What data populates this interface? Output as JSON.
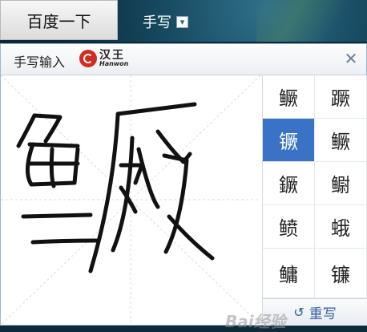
{
  "topbar": {
    "search_button_label": "百度一下",
    "mode_label": "手写",
    "mode_dropdown_icon": "chevron-down-icon"
  },
  "panel": {
    "title": "手写输入",
    "logo": {
      "cn": "汉王",
      "en": "Hanwon"
    },
    "close_label": "✕"
  },
  "candidates": [
    "鳜",
    "蹶",
    "镢",
    "鳜",
    "鐝",
    "鳚",
    "鲼",
    "蛾",
    "鳙",
    "镰"
  ],
  "selected_index": 2,
  "rewrite_label": "重写",
  "colors": {
    "accent": "#3a73c6",
    "rewrite_text": "#2f5f9c",
    "hanwon_red": "#d32a22"
  },
  "watermark": "Bai经验"
}
